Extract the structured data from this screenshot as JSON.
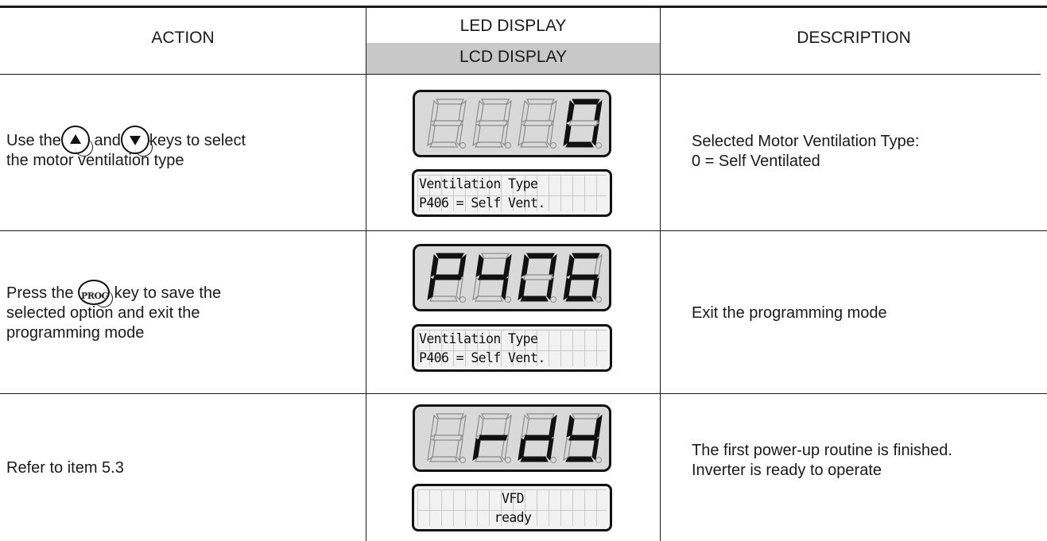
{
  "header": {
    "action": "ACTION",
    "led_display": "LED DISPLAY",
    "lcd_display": "LCD DISPLAY",
    "description": "DESCRIPTION"
  },
  "rows": [
    {
      "action_before": "Use the",
      "action_mid": "and",
      "action_after": "keys to select",
      "action_line2": "the motor ventilation type",
      "keys": [
        "up-arrow-key",
        "down-arrow-key"
      ],
      "led": "   0",
      "lcd_line1": "Ventilation Type",
      "lcd_line2": "P406 = Self Vent.",
      "desc_line1": "Selected Motor Ventilation Type:",
      "desc_line2": "0 = Self Ventilated"
    },
    {
      "action_before": "Press the",
      "prog_key_label": "PROG",
      "action_after": "key to save the",
      "action_line2": "selected option and exit the",
      "action_line3": "programming mode",
      "led": "P406",
      "lcd_line1": "Ventilation Type",
      "lcd_line2": "P406 = Self Vent.",
      "desc_line1": "Exit the programming mode"
    },
    {
      "action_line1": "Refer to item 5.3",
      "led": " rdy",
      "lcd_line1": "VFD",
      "lcd_line2": "ready",
      "desc_line1": "The first power-up routine is finished.",
      "desc_line2": "Inverter is ready to operate"
    }
  ]
}
